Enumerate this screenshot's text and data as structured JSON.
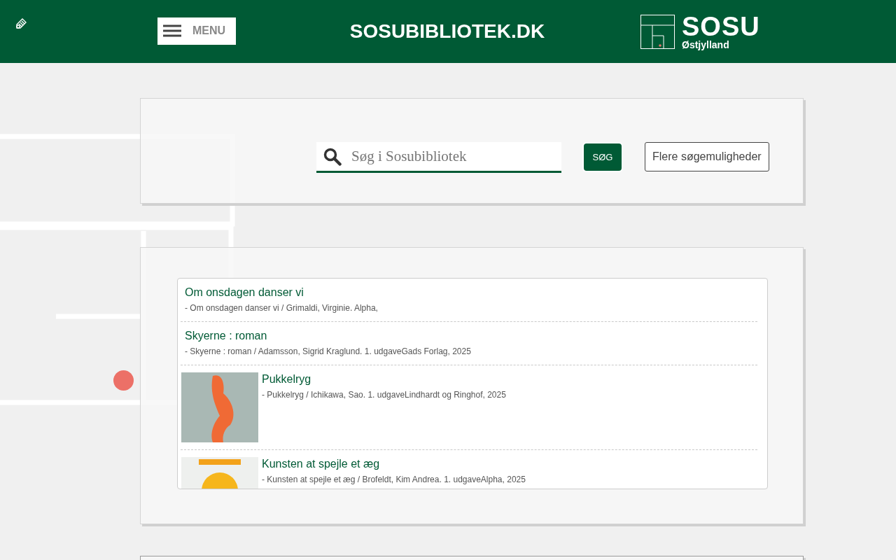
{
  "header": {
    "menu_label": "MENU",
    "site_title": "SOSUBIBLIOTEK.DK",
    "logo": {
      "name": "SOSU",
      "subtitle": "Østjylland"
    }
  },
  "search": {
    "placeholder": "Søg i Sosubibliotek",
    "button": "SØG",
    "more_button": "Flere søgemuligheder"
  },
  "results": [
    {
      "title": "Om onsdagen danser vi",
      "details": "- Om onsdagen danser vi / Grimaldi, Virginie. Alpha,",
      "has_cover": false
    },
    {
      "title": "Skyerne : roman",
      "details": "- Skyerne : roman / Adamsson, Sigrid Kraglund. 1. udgaveGads Forlag, 2025",
      "has_cover": false
    },
    {
      "title": "Pukkelryg",
      "details": "- Pukkelryg / Ichikawa, Sao. 1. udgaveLindhardt og Ringhof, 2025",
      "has_cover": true
    },
    {
      "title": "Kunsten at spejle et æg",
      "details": "- Kunsten at spejle et æg / Brofeldt, Kim Andrea. 1. udgaveAlpha, 2025",
      "has_cover": true
    }
  ]
}
